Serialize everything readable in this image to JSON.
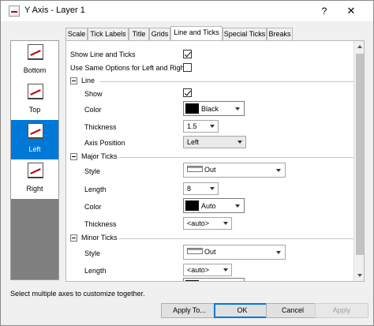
{
  "window": {
    "title": "Y Axis - Layer 1",
    "help_label": "?",
    "close_label": "✕",
    "stub_char": "1"
  },
  "sidebar": {
    "items": [
      {
        "label": "Bottom",
        "icon": "axis-bottom-icon"
      },
      {
        "label": "Top",
        "icon": "axis-top-icon"
      },
      {
        "label": "Left",
        "icon": "axis-left-icon"
      },
      {
        "label": "Right",
        "icon": "axis-right-icon"
      }
    ],
    "selected": "Left"
  },
  "tabs": [
    "Scale",
    "Tick Labels",
    "Title",
    "Grids",
    "Line and Ticks",
    "Special Ticks",
    "Breaks"
  ],
  "active_tab": "Line and Ticks",
  "panel": {
    "show_line_ticks": {
      "label": "Show Line and Ticks",
      "checked": true
    },
    "same_options": {
      "label": "Use Same Options for Left and Right",
      "checked": false
    },
    "line": {
      "title": "Line",
      "show_label": "Show",
      "show_checked": true,
      "color_label": "Color",
      "color_value": "Black",
      "thickness_label": "Thickness",
      "thickness_value": "1.5",
      "axis_position_label": "Axis Position",
      "axis_position_value": "Left"
    },
    "major_ticks": {
      "title": "Major Ticks",
      "style_label": "Style",
      "style_value": "Out",
      "length_label": "Length",
      "length_value": "8",
      "color_label": "Color",
      "color_value": "Auto",
      "thickness_label": "Thickness",
      "thickness_value": "<auto>"
    },
    "minor_ticks": {
      "title": "Minor Ticks",
      "style_label": "Style",
      "style_value": "Out",
      "length_label": "Length",
      "length_value": "<auto>"
    }
  },
  "footer": {
    "hint": "Select multiple axes to customize together.",
    "apply_to_label": "Apply To...",
    "ok_label": "OK",
    "cancel_label": "Cancel",
    "apply_label": "Apply"
  },
  "colors": {
    "selection": "#0078d7",
    "swatch": "#000000"
  }
}
